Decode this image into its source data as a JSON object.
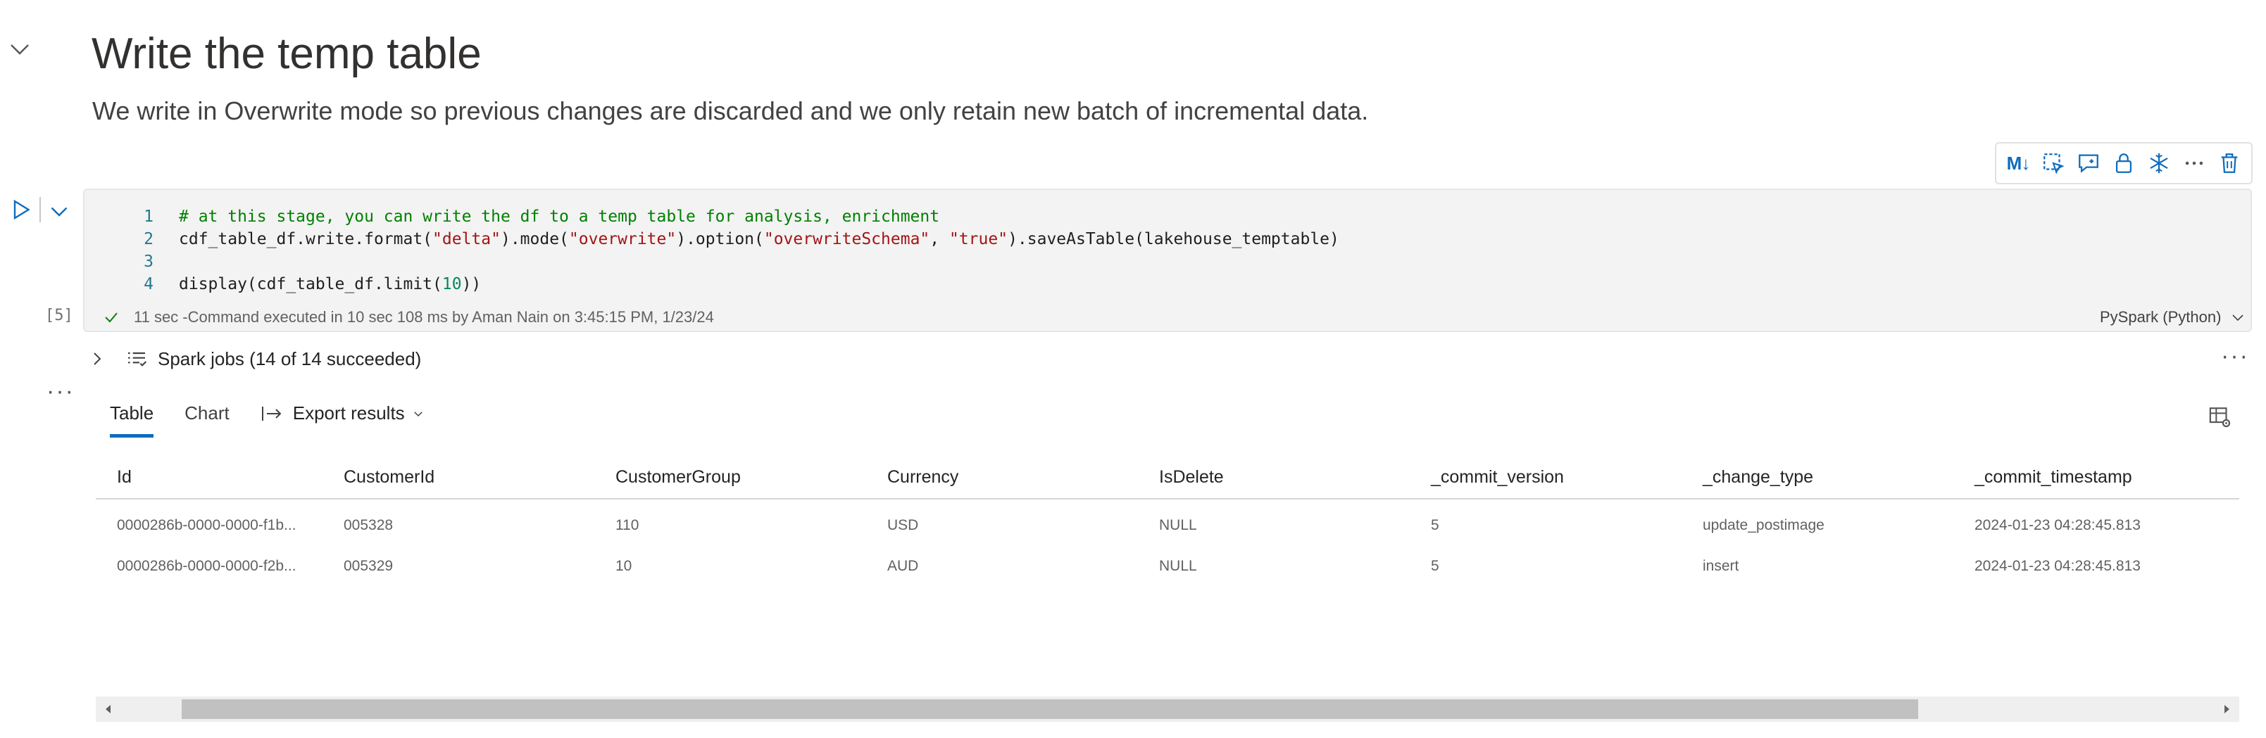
{
  "markdown": {
    "title": "Write the temp table",
    "description": "We write in Overwrite mode so previous changes are discarded and we only retain new batch of incremental data."
  },
  "cell_toolbar": {
    "markdown_label": "M↓"
  },
  "cell": {
    "execution_count": "[5]",
    "code_lines": [
      {
        "number": "1",
        "tokens": [
          {
            "t": "# at this stage, you can write the df to a temp table for analysis, enrichment",
            "k": "comment"
          }
        ]
      },
      {
        "number": "2",
        "tokens": [
          {
            "t": "cdf_table_df.write.format(",
            "k": "plain"
          },
          {
            "t": "\"delta\"",
            "k": "str"
          },
          {
            "t": ").mode(",
            "k": "plain"
          },
          {
            "t": "\"overwrite\"",
            "k": "str"
          },
          {
            "t": ").option(",
            "k": "plain"
          },
          {
            "t": "\"overwriteSchema\"",
            "k": "str"
          },
          {
            "t": ", ",
            "k": "plain"
          },
          {
            "t": "\"true\"",
            "k": "str"
          },
          {
            "t": ").saveAsTable(lakehouse_temptable)",
            "k": "plain"
          }
        ]
      },
      {
        "number": "3",
        "tokens": []
      },
      {
        "number": "4",
        "tokens": [
          {
            "t": "display(cdf_table_df.limit(",
            "k": "plain"
          },
          {
            "t": "10",
            "k": "num"
          },
          {
            "t": "))",
            "k": "plain"
          }
        ]
      }
    ],
    "status_text": "11 sec -Command executed in 10 sec 108 ms by Aman Nain on 3:45:15 PM, 1/23/24",
    "language": "PySpark (Python)"
  },
  "spark_jobs": {
    "label": "Spark jobs (14 of 14 succeeded)"
  },
  "output": {
    "tabs": [
      {
        "label": "Table",
        "active": true
      },
      {
        "label": "Chart",
        "active": false
      }
    ],
    "export_label": "Export results"
  },
  "table": {
    "columns": [
      "Id",
      "CustomerId",
      "CustomerGroup",
      "Currency",
      "IsDelete",
      "_commit_version",
      "_change_type",
      "_commit_timestamp"
    ],
    "rows": [
      [
        "0000286b-0000-0000-f1b...",
        "005328",
        "110",
        "USD",
        "NULL",
        "5",
        "update_postimage",
        "2024-01-23 04:28:45.813"
      ],
      [
        "0000286b-0000-0000-f2b...",
        "005329",
        "10",
        "AUD",
        "NULL",
        "5",
        "insert",
        "2024-01-23 04:28:45.813"
      ]
    ]
  },
  "scrollbar": {
    "thumb_start_fraction": 0.04,
    "thumb_length_fraction": 0.81
  },
  "colors": {
    "accent": "#0f6cbd",
    "code_bg": "#f3f3f3",
    "success": "#107c10"
  }
}
